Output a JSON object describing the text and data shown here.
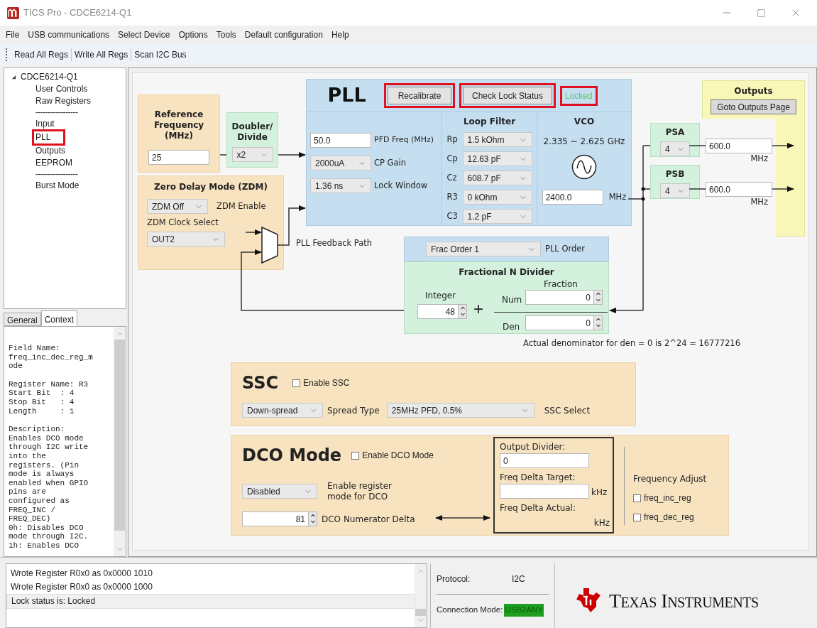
{
  "window": {
    "title": "TICS Pro - CDCE6214-Q1"
  },
  "menu": [
    "File",
    "USB communications",
    "Select Device",
    "Options",
    "Tools",
    "Default configuration",
    "Help"
  ],
  "toolbar": [
    "Read All Regs",
    "Write All Regs",
    "Scan I2C Bus"
  ],
  "tree": {
    "label": "CDCE6214-Q1",
    "expanded": true,
    "children": [
      {
        "kind": "item",
        "label": "User Controls",
        "highlighted": false
      },
      {
        "kind": "item",
        "label": "Raw Registers",
        "highlighted": false
      },
      {
        "kind": "separator",
        "label": "-----------------"
      },
      {
        "kind": "item",
        "label": "Input",
        "highlighted": false
      },
      {
        "kind": "item",
        "label": "PLL",
        "highlighted": true
      },
      {
        "kind": "item",
        "label": "Outputs",
        "highlighted": false
      },
      {
        "kind": "item",
        "label": "EEPROM",
        "highlighted": false
      },
      {
        "kind": "separator",
        "label": "-----------------"
      },
      {
        "kind": "item",
        "label": "Burst Mode",
        "highlighted": false
      }
    ]
  },
  "side_tabs": [
    {
      "label": "General",
      "selected": false
    },
    {
      "label": "Context",
      "selected": true
    }
  ],
  "context": [
    [
      "Field Name:",
      "freq_inc_dec_reg_m",
      "ode"
    ],
    [
      "Register Name: R3",
      "Start Bit  : 4",
      "Stop Bit   : 4",
      "Length     : 1"
    ],
    [
      "Description:",
      "Enables DCO mode",
      "through I2C write",
      "into the",
      "registers. (Pin",
      "mode is always",
      "enabled when GPIO",
      "pins are",
      "configured as",
      "FREQ_INC /",
      "FREQ_DEC)",
      "0h: Disables DCO",
      "mode through I2C.",
      "1h: Enables DCO"
    ]
  ],
  "reference": {
    "title": "Reference Frequency (MHz)",
    "value": "25"
  },
  "doubler": {
    "title": "Doubler/ Divide",
    "value": "x2"
  },
  "zdm": {
    "title": "Zero Delay Mode (ZDM)",
    "mode": "ZDM Off",
    "mode_label": "ZDM Enable",
    "clock_label": "ZDM Clock Select",
    "clock": "OUT2",
    "feedback_label": "PLL Feedback Path"
  },
  "pll": {
    "title": "PLL",
    "buttons": [
      {
        "label": "Recalibrate",
        "highlighted": true
      },
      {
        "label": "Check Lock Status",
        "highlighted": true
      }
    ],
    "status": {
      "text": "Locked",
      "color": "#5cc36e",
      "highlighted": true
    },
    "pfd": {
      "value": "50.0",
      "label": "PFD Freq (MHz)"
    },
    "cp_gain": {
      "value": "2000uA",
      "label": "CP Gain"
    },
    "lock_window": {
      "value": "1.36 ns",
      "label": "Lock Window"
    },
    "loop_filter": {
      "title": "Loop Filter",
      "rows": [
        {
          "label": "Rp",
          "value": "1.5 kOhm"
        },
        {
          "label": "Cp",
          "value": "12.63 pF"
        },
        {
          "label": "Cz",
          "value": "608.7 pF"
        },
        {
          "label": "R3",
          "value": "0 kOhm"
        },
        {
          "label": "C3",
          "value": "1.2 pF"
        }
      ]
    },
    "vco": {
      "title": "VCO",
      "range": "2.335 ~ 2.625 GHz",
      "value": "2400.0",
      "unit": "MHz"
    }
  },
  "outputs": {
    "title": "Outputs",
    "button": "Goto Outputs Page"
  },
  "dividers": [
    {
      "title": "PSA",
      "value": "4",
      "freq": "600.0",
      "unit": "MHz"
    },
    {
      "title": "PSB",
      "value": "4",
      "freq": "600.0",
      "unit": "MHz"
    }
  ],
  "frac": {
    "order": "Frac Order 1",
    "order_label": "PLL Order",
    "title": "Fractional N Divider",
    "integer_label": "Integer",
    "integer": "48",
    "plus": "+",
    "fraction_label": "Fraction",
    "num_label": "Num",
    "num": "0",
    "den_label": "Den",
    "den": "0",
    "note": "Actual denominator for den = 0 is 2^24 = 16777216"
  },
  "ssc": {
    "title": "SSC",
    "enable": {
      "label": "Enable SSC",
      "checked": false
    },
    "type": "Down-spread",
    "type_label": "Spread Type",
    "select": "25MHz PFD, 0.5%",
    "select_label": "SSC Select"
  },
  "dco": {
    "title": "DCO Mode",
    "enable": {
      "label": "Enable DCO Mode",
      "checked": false
    },
    "mode": "Disabled",
    "mode_label": "Enable register mode for DCO",
    "delta": "81",
    "delta_label": "DCO Numerator Delta",
    "output_divider_label": "Output Divider:",
    "output_divider": "0",
    "target_label": "Freq Delta Target:",
    "target_unit": "kHz",
    "actual_label": "Freq Delta Actual:",
    "actual_unit": "kHz",
    "adjust_title": "Frequency Adjust",
    "adjust": [
      {
        "label": "freq_inc_reg",
        "checked": false
      },
      {
        "label": "freq_dec_reg",
        "checked": false
      }
    ]
  },
  "log": [
    {
      "text": "Wrote Register R0x0 as 0x0000 1010",
      "selected": false
    },
    {
      "text": "Wrote Register R0x0 as 0x0000 1000",
      "selected": false
    },
    {
      "text": "Lock status is: Locked",
      "selected": true
    }
  ],
  "status": {
    "protocol_label": "Protocol:",
    "protocol": "I2C",
    "connection_label": "Connection Mode:",
    "connection": {
      "text": "USB2ANY",
      "color": "#1f9e1f"
    }
  },
  "logo": {
    "text": "Texas Instruments"
  }
}
